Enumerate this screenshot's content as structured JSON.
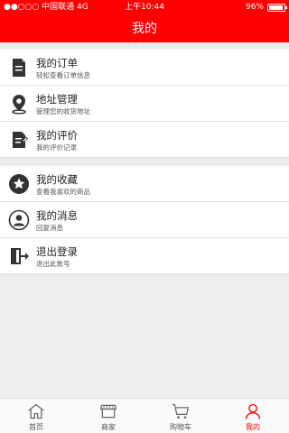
{
  "status_bar": {
    "carrier": "●●○○○ 中国联通  4G",
    "time": "上午10:44",
    "battery": "96%"
  },
  "header": {
    "title": "我的"
  },
  "menu_group1": [
    {
      "label": "我的订单",
      "sub": "轻松查看订单信息",
      "icon": "order-icon"
    },
    {
      "label": "地址管理",
      "sub": "管理您的收货地址",
      "icon": "location-pin-icon"
    },
    {
      "label": "我的评价",
      "sub": "我的评价记录",
      "icon": "review-icon"
    }
  ],
  "menu_group2": [
    {
      "label": "我的收藏",
      "sub": "查看我喜欢的商品",
      "icon": "star-icon"
    },
    {
      "label": "我的消息",
      "sub": "回复消息",
      "icon": "user-message-icon"
    },
    {
      "label": "退出登录",
      "sub": "退出此账号",
      "icon": "logout-icon"
    }
  ],
  "tabbar": {
    "items": [
      {
        "label": "首页",
        "icon": "home-icon"
      },
      {
        "label": "商家",
        "icon": "store-icon"
      },
      {
        "label": "购物车",
        "icon": "cart-icon"
      },
      {
        "label": "我的",
        "icon": "profile-icon"
      }
    ],
    "active_color": "#ff0000",
    "accent_color": "#ff0000"
  }
}
